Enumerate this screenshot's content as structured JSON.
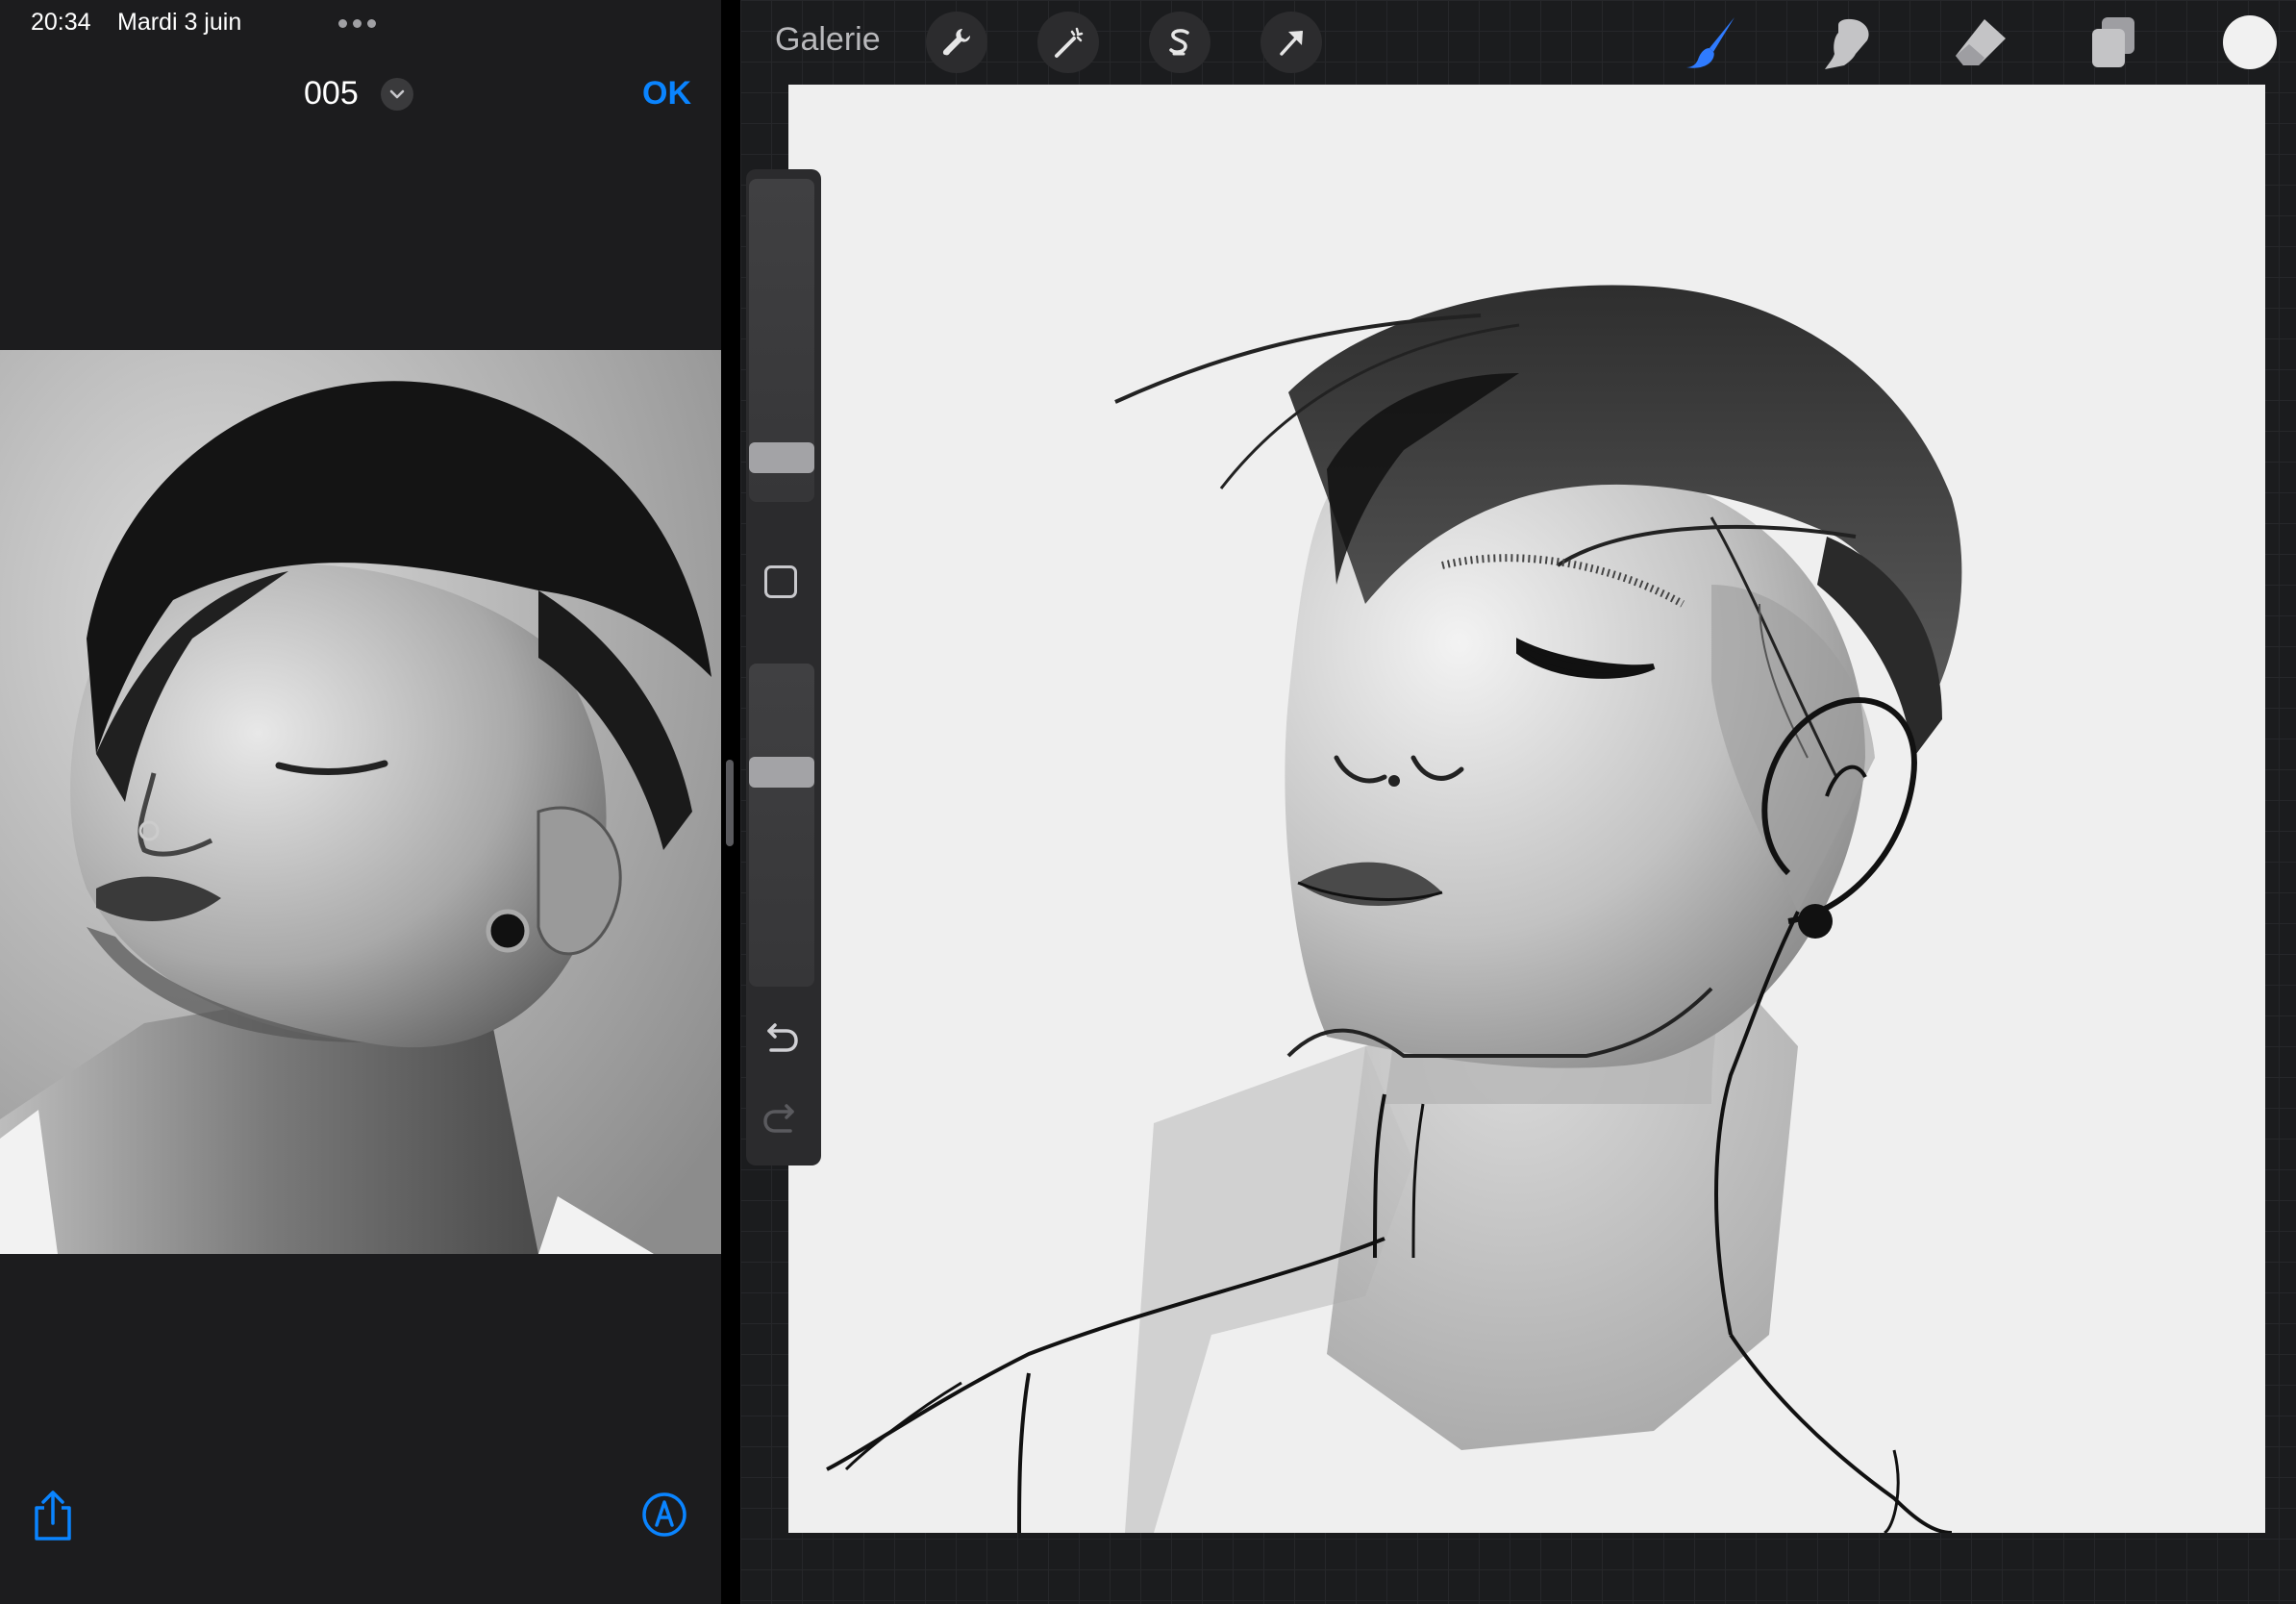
{
  "status_bar": {
    "time": "20:34",
    "date": "Mardi 3 juin"
  },
  "viewer": {
    "title": "005",
    "done_label": "OK",
    "icons": {
      "menu": "more-dots-icon",
      "title_menu": "chevron-down-icon",
      "share": "share-icon",
      "markup": "markup-pen-icon"
    },
    "accent_color": "#0a84ff"
  },
  "procreate": {
    "gallery_label": "Galerie",
    "toolbar_left": [
      "wrench-icon",
      "magic-wand-icon",
      "selection-icon",
      "transform-arrow-icon"
    ],
    "toolbar_right": [
      "brush-icon",
      "smudge-icon",
      "eraser-icon",
      "layers-icon"
    ],
    "active_tool": "brush",
    "active_color": "#f1f1f1",
    "brush_accent": "#2f7bff",
    "sidebar": {
      "brush_size": 0.1,
      "opacity": 0.68
    }
  }
}
